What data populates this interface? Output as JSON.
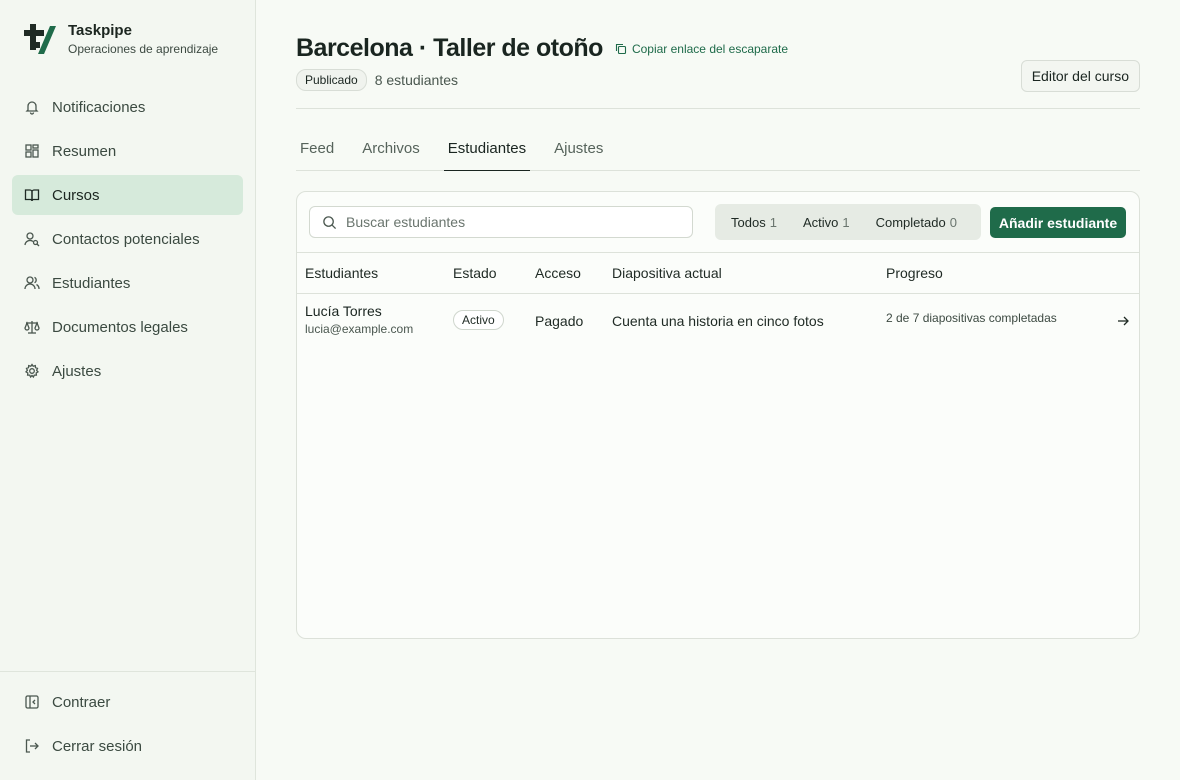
{
  "brand": {
    "name": "Taskpipe",
    "subtitle": "Operaciones de aprendizaje"
  },
  "sidebar": {
    "items": [
      {
        "label": "Notificaciones",
        "icon": "bell-icon"
      },
      {
        "label": "Resumen",
        "icon": "dashboard-icon"
      },
      {
        "label": "Cursos",
        "icon": "book-icon",
        "active": true
      },
      {
        "label": "Contactos potenciales",
        "icon": "user-search-icon"
      },
      {
        "label": "Estudiantes",
        "icon": "users-icon"
      },
      {
        "label": "Documentos legales",
        "icon": "scale-icon"
      },
      {
        "label": "Ajustes",
        "icon": "gear-icon"
      }
    ],
    "bottom": [
      {
        "label": "Contraer",
        "icon": "collapse-icon"
      },
      {
        "label": "Cerrar sesión",
        "icon": "logout-icon"
      }
    ]
  },
  "header": {
    "title": "Barcelona · Taller de otoño",
    "copy_link": "Copiar enlace del escaparate",
    "status_badge": "Publicado",
    "students_count": "8 estudiantes",
    "editor_button": "Editor del curso"
  },
  "tabs": [
    {
      "label": "Feed"
    },
    {
      "label": "Archivos"
    },
    {
      "label": "Estudiantes",
      "active": true
    },
    {
      "label": "Ajustes"
    }
  ],
  "toolbar": {
    "search_placeholder": "Buscar estudiantes",
    "filters": [
      {
        "label": "Todos",
        "count": "1"
      },
      {
        "label": "Activo",
        "count": "1"
      },
      {
        "label": "Completado",
        "count": "0"
      }
    ],
    "add_button": "Añadir estudiante"
  },
  "table": {
    "columns": [
      "Estudiantes",
      "Estado",
      "Acceso",
      "Diapositiva actual",
      "Progreso"
    ],
    "rows": [
      {
        "name": "Lucía Torres",
        "email": "lucia@example.com",
        "status": "Activo",
        "access": "Pagado",
        "current_slide": "Cuenta una historia en cinco fotos",
        "progress": "2 de 7 diapositivas completadas"
      }
    ]
  },
  "colors": {
    "accent": "#1f6b4a",
    "sidebar_active": "#d6eadb",
    "background": "#f7faf5"
  }
}
